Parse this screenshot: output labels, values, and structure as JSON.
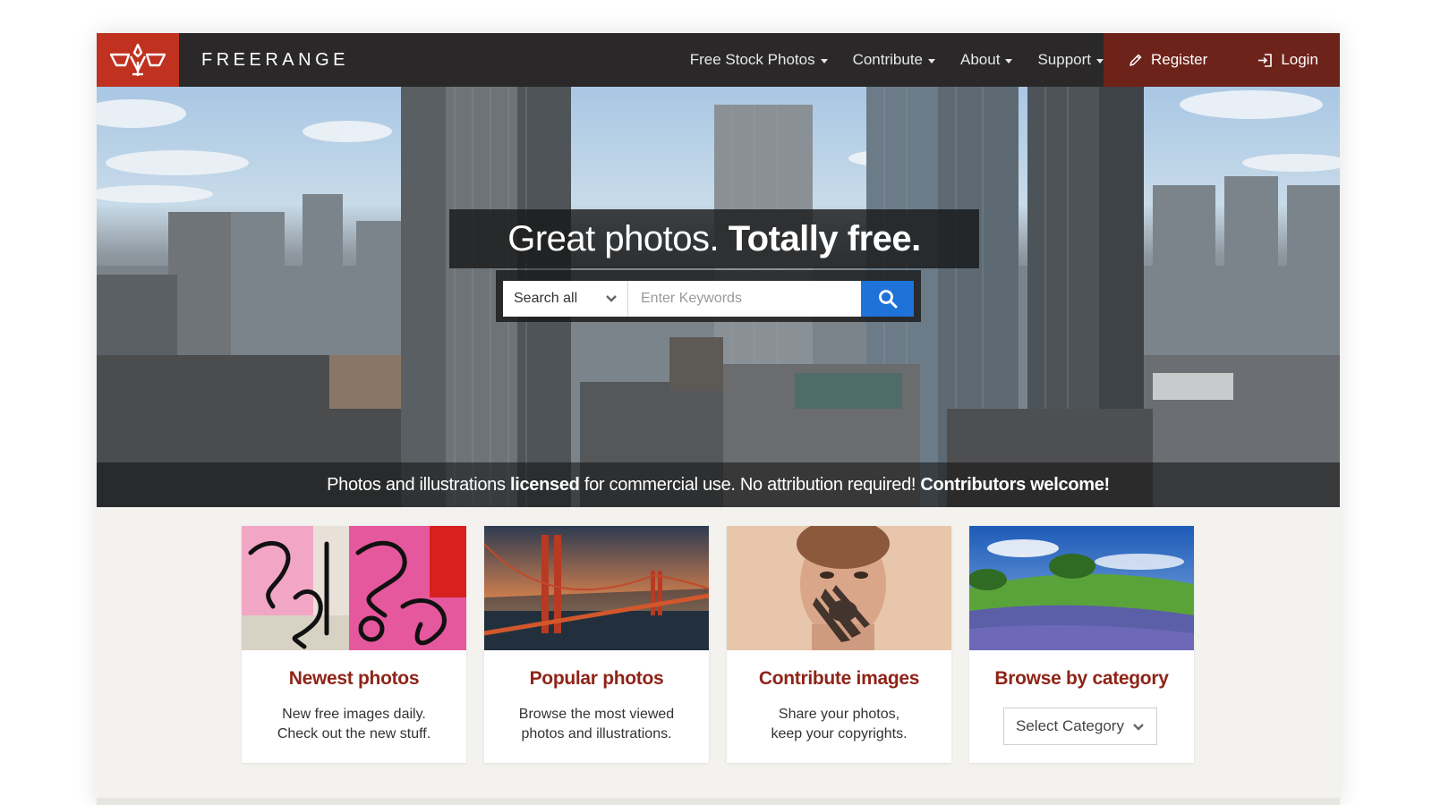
{
  "nav": {
    "brand": "FREERANGE",
    "menu": [
      {
        "label": "Free Stock Photos"
      },
      {
        "label": "Contribute"
      },
      {
        "label": "About"
      },
      {
        "label": "Support"
      }
    ],
    "register_label": "Register",
    "login_label": "Login"
  },
  "hero": {
    "headline_regular": "Great photos.",
    "headline_bold": "Totally free.",
    "search": {
      "scope_selected": "Search all",
      "placeholder": "Enter Keywords"
    },
    "tagline": {
      "part1": "Photos and illustrations ",
      "bold1": "licensed",
      "part2": " for commercial use. No attribution required! ",
      "bold2": "Contributors welcome!"
    }
  },
  "cards": [
    {
      "title": "Newest photos",
      "line1": "New free images daily.",
      "line2": "Check out the new stuff."
    },
    {
      "title": "Popular photos",
      "line1": "Browse the most viewed",
      "line2": "photos and illustrations."
    },
    {
      "title": "Contribute images",
      "line1": "Share your photos,",
      "line2": "keep your copyrights."
    },
    {
      "title": "Browse by category",
      "select_label": "Select Category"
    }
  ],
  "colors": {
    "brand_red": "#c0311f",
    "nav_dark": "#2a2828",
    "auth_bg": "#6e231a",
    "search_blue": "#1e72d8",
    "card_title": "#8f2418"
  },
  "icons": [
    "freerange-logo-icon",
    "pencil-icon",
    "login-icon",
    "chevron-down-icon",
    "search-icon"
  ]
}
